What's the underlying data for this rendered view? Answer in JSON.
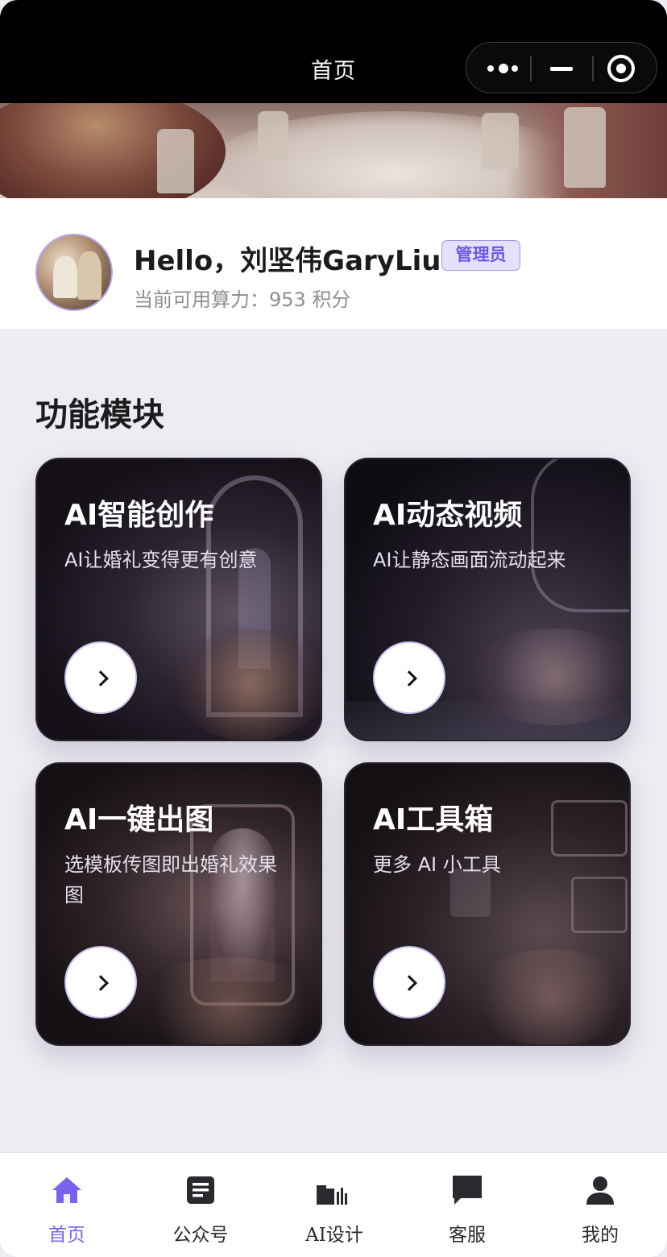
{
  "navbar": {
    "title": "首页",
    "capsule": {
      "more_icon": "more-dots-icon",
      "minimize_icon": "minimize-icon",
      "close_icon": "close-circle-icon"
    }
  },
  "banner": {
    "image": "banquet-hall-photo"
  },
  "profile": {
    "greeting": "Hello，刘坚伟GaryLiu",
    "role_badge": "管理员",
    "points_text": "当前可用算力：953 积分",
    "avatar": "user-avatar-photo"
  },
  "section": {
    "title": "功能模块"
  },
  "modules": [
    {
      "title": "AI智能创作",
      "desc": "AI让婚礼变得更有创意"
    },
    {
      "title": "AI动态视频",
      "desc": "AI让静态画面流动起来"
    },
    {
      "title": "AI一键出图",
      "desc": "选模板传图即出婚礼效果图"
    },
    {
      "title": "AI工具箱",
      "desc": "更多 AI 小工具"
    }
  ],
  "tabbar": {
    "items": [
      {
        "label": "首页",
        "icon": "home-icon",
        "active": true
      },
      {
        "label": "公众号",
        "icon": "article-icon",
        "active": false
      },
      {
        "label": "AI设计",
        "icon": "chart-bars-icon",
        "active": false
      },
      {
        "label": "客服",
        "icon": "chat-bubble-icon",
        "active": false
      },
      {
        "label": "我的",
        "icon": "user-icon",
        "active": false
      }
    ]
  },
  "colors": {
    "accent": "#7b62ee",
    "navbar": "#000000",
    "page_bg": "#ececf1",
    "card_bg": "#16121a"
  }
}
